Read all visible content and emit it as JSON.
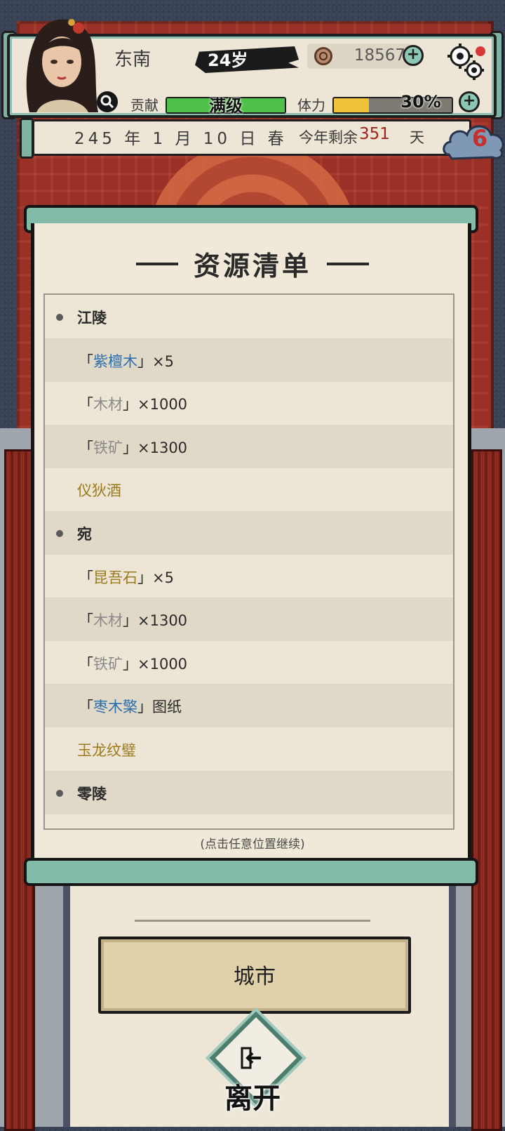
{
  "header": {
    "region": "东南",
    "age": "24岁",
    "coins": "18567",
    "contribution_label": "贡献",
    "contribution_text": "满级",
    "contribution_level": 1.0,
    "stamina_label": "体力",
    "stamina_text": "30%",
    "stamina_level": 0.3
  },
  "date": {
    "text": "245 年 1 月 10 日 春",
    "remaining_label": "今年剩余",
    "remaining_days": "351",
    "remaining_unit": "天",
    "badge_count": "6"
  },
  "dialog": {
    "title": "资源清单",
    "hint": "(点击任意位置继续)",
    "rows": [
      {
        "kind": "city",
        "name": "江陵"
      },
      {
        "kind": "item",
        "open": "「",
        "name": "紫檀木",
        "close": "」",
        "suffix": "×5",
        "color": "#2d6fae"
      },
      {
        "kind": "item",
        "open": "「",
        "name": "木材",
        "close": "」",
        "suffix": "×1000",
        "color": "#8a8a8a"
      },
      {
        "kind": "item",
        "open": "「",
        "name": "铁矿",
        "close": "」",
        "suffix": "×1300",
        "color": "#8a8a8a"
      },
      {
        "kind": "special",
        "name": "仪狄酒",
        "color": "#9b7a1e"
      },
      {
        "kind": "city",
        "name": "宛"
      },
      {
        "kind": "item",
        "open": "「",
        "name": "昆吾石",
        "close": "」",
        "suffix": "×5",
        "color": "#9b7a1e"
      },
      {
        "kind": "item",
        "open": "「",
        "name": "木材",
        "close": "」",
        "suffix": "×1300",
        "color": "#8a8a8a"
      },
      {
        "kind": "item",
        "open": "「",
        "name": "铁矿",
        "close": "」",
        "suffix": "×1000",
        "color": "#8a8a8a"
      },
      {
        "kind": "item",
        "open": "「",
        "name": "枣木檠",
        "close": "」",
        "suffix": "图纸",
        "color": "#2d6fae"
      },
      {
        "kind": "special",
        "name": "玉龙纹璧",
        "color": "#9b7a1e"
      },
      {
        "kind": "city",
        "name": "零陵"
      }
    ]
  },
  "actions": {
    "city_label": "城市",
    "leave_label": "离开"
  },
  "colors": {
    "contribution_bar": "#4fc04a",
    "stamina_bar": "#f0c23a",
    "accent_teal": "#83bba9",
    "hall_red": "#9a3026"
  }
}
